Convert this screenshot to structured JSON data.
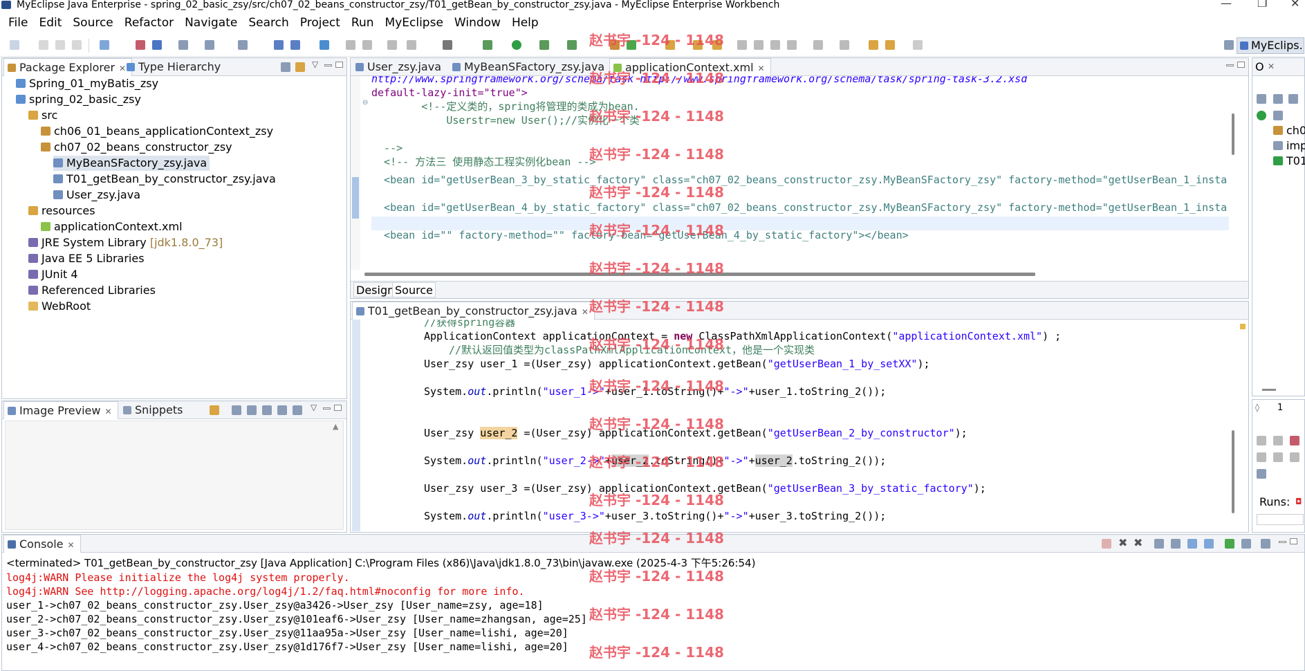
{
  "window": {
    "title": "MyEclipse Java Enterprise - spring_02_basic_zsy/src/ch07_02_beans_constructor_zsy/T01_getBean_by_constructor_zsy.java - MyEclipse Enterprise Workbench"
  },
  "menu": [
    "File",
    "Edit",
    "Source",
    "Refactor",
    "Navigate",
    "Search",
    "Project",
    "Run",
    "MyEclipse",
    "Window",
    "Help"
  ],
  "perspective": "MyEclips...",
  "watermark": "赵书宇 -124 - 1148",
  "package_explorer": {
    "tabs": [
      "Package Explorer",
      "Type Hierarchy"
    ],
    "items": [
      {
        "label": "Spring_01_myBatis_zsy",
        "indent": 0,
        "icon": "project-icon",
        "color": "#5b8fd1"
      },
      {
        "label": "spring_02_basic_zsy",
        "indent": 0,
        "icon": "project-icon",
        "color": "#5b8fd1"
      },
      {
        "label": "src",
        "indent": 1,
        "icon": "source-folder-icon",
        "color": "#d9a441"
      },
      {
        "label": "ch06_01_beans_applicationContext_zsy",
        "indent": 2,
        "icon": "package-icon",
        "color": "#c7923a"
      },
      {
        "label": "ch07_02_beans_constructor_zsy",
        "indent": 2,
        "icon": "package-icon",
        "color": "#c7923a"
      },
      {
        "label": "MyBeanSFactory_zsy.java",
        "indent": 3,
        "icon": "java-file-icon",
        "color": "#6f8fbf",
        "selected": true
      },
      {
        "label": "T01_getBean_by_constructor_zsy.java",
        "indent": 3,
        "icon": "java-file-icon",
        "color": "#6f8fbf"
      },
      {
        "label": "User_zsy.java",
        "indent": 3,
        "icon": "java-file-icon",
        "color": "#6f8fbf"
      },
      {
        "label": "resources",
        "indent": 1,
        "icon": "source-folder-icon",
        "color": "#d9a441"
      },
      {
        "label": "applicationContext.xml",
        "indent": 2,
        "icon": "xml-file-icon",
        "color": "#8bc34a"
      },
      {
        "label": "JRE System Library",
        "suffix": "[jdk1.8.0_73]",
        "indent": 1,
        "icon": "library-icon",
        "color": "#7a6bb0"
      },
      {
        "label": "Java EE 5 Libraries",
        "indent": 1,
        "icon": "library-icon",
        "color": "#7a6bb0"
      },
      {
        "label": "JUnit 4",
        "indent": 1,
        "icon": "library-icon",
        "color": "#7a6bb0"
      },
      {
        "label": "Referenced Libraries",
        "indent": 1,
        "icon": "library-icon",
        "color": "#7a6bb0"
      },
      {
        "label": "WebRoot",
        "indent": 1,
        "icon": "folder-icon",
        "color": "#e3b85c"
      }
    ]
  },
  "image_preview": {
    "tabs": [
      "Image Preview",
      "Snippets"
    ]
  },
  "top_editor": {
    "tabs": [
      "User_zsy.java",
      "MyBeanSFactory_zsy.java",
      "applicationContext.xml"
    ],
    "active_tab": 2,
    "bottom_tabs": [
      "Design",
      "Source"
    ],
    "lines": [
      "http://www.springframework.org/schema/task http://www.springframework.org/schema/task/spring-task-3.2.xsd",
      "default-lazy-init=\"true\">",
      "        <!--定义类的，spring将管理的类成为bean.",
      "            Userstr=new User();//实例化一个类",
      "",
      "  -->",
      "  <!-- 方法三 使用静态工程实例化bean -->",
      "  <bean id=\"getUserBean_3_by_static_factory\" class=\"ch07_02_beans_constructor_zsy.MyBeanSFactory_zsy\" factory-method=\"getUserBean_1_insta",
      "",
      "  <bean id=\"getUserBean_4_by_static_factory\" class=\"ch07_02_beans_constructor_zsy.MyBeanSFactory_zsy\" factory-method=\"getUserBean_1_insta",
      "",
      "  <bean id=\"\" factory-method=\"\" factory-bean=\"getUserBean_4_by_static_factory\"></bean>"
    ]
  },
  "bottom_editor": {
    "tab": "T01_getBean_by_constructor_zsy.java",
    "lines": {
      "l1": "//获得spring容器",
      "l2a": "ApplicationContext applicationContext = ",
      "l2kw": "new",
      "l2b": " ClassPathXmlApplicationContext(",
      "l2s": "\"applicationContext.xml\"",
      "l2c": ") ;",
      "l3": "//默认返回值类型为classPathXmlApplicationContext，他是一个实现类",
      "l4a": "User_zsy user_1 =(User_zsy) applicationContext.getBean(",
      "l4s": "\"getUserBean_1_by_setXX\"",
      "l4c": ");",
      "p1a": "System.",
      "p1out": "out",
      "p1b": ".println(",
      "p1s1": "\"user_1->\"",
      "p1c": "+user_1.toString()+",
      "p1s2": "\"->\"",
      "p1d": "+user_1.toString_2());",
      "u2a": "User_zsy ",
      "u2v": "user_2",
      "u2b": " =(User_zsy) applicationContext.getBean(",
      "u2s": "\"getUserBean_2_by_constructor\"",
      "u2c": ");",
      "p2s1": "\"user_2->\"",
      "p2v1": "user_2",
      "p2c": ".toString()+",
      "p2s2": "\"->\"",
      "p2v2": "user_2",
      "p2d": ".toString_2());",
      "u3a": "User_zsy user_3 =(User_zsy) applicationContext.getBean(",
      "u3s": "\"getUserBean_3_by_static_factory\"",
      "u3c": ");",
      "p3s1": "\"user_3->\"",
      "p3c": "+user_3.toString()+",
      "p3s2": "\"->\"",
      "p3d": "+user_3.toString_2());"
    }
  },
  "outline": {
    "items": [
      "ch0",
      "imp",
      "T01"
    ]
  },
  "junit": {
    "runs_label": "Runs:",
    "count_label": "1"
  },
  "console": {
    "tab": "Console",
    "header": "<terminated> T01_getBean_by_constructor_zsy [Java Application] C:\\Program Files (x86)\\Java\\jdk1.8.0_73\\bin\\javaw.exe (2025-4-3 下午5:26:54)",
    "lines": [
      {
        "text": "log4j:WARN Please initialize the log4j system properly.",
        "warn": true
      },
      {
        "text": "log4j:WARN See http://logging.apache.org/log4j/1.2/faq.html#noconfig for more info.",
        "warn": true
      },
      {
        "text": "user_1->ch07_02_beans_constructor_zsy.User_zsy@a3426->User_zsy [User_name=zsy, age=18]",
        "warn": false
      },
      {
        "text": "user_2->ch07_02_beans_constructor_zsy.User_zsy@101eaf6->User_zsy [User_name=zhangsan, age=25]",
        "warn": false
      },
      {
        "text": "user_3->ch07_02_beans_constructor_zsy.User_zsy@11aa95a->User_zsy [User_name=lishi, age=20]",
        "warn": false
      },
      {
        "text": "user_4->ch07_02_beans_constructor_zsy.User_zsy@1d176f7->User_zsy [User_name=lishi, age=20]",
        "warn": false
      }
    ]
  }
}
